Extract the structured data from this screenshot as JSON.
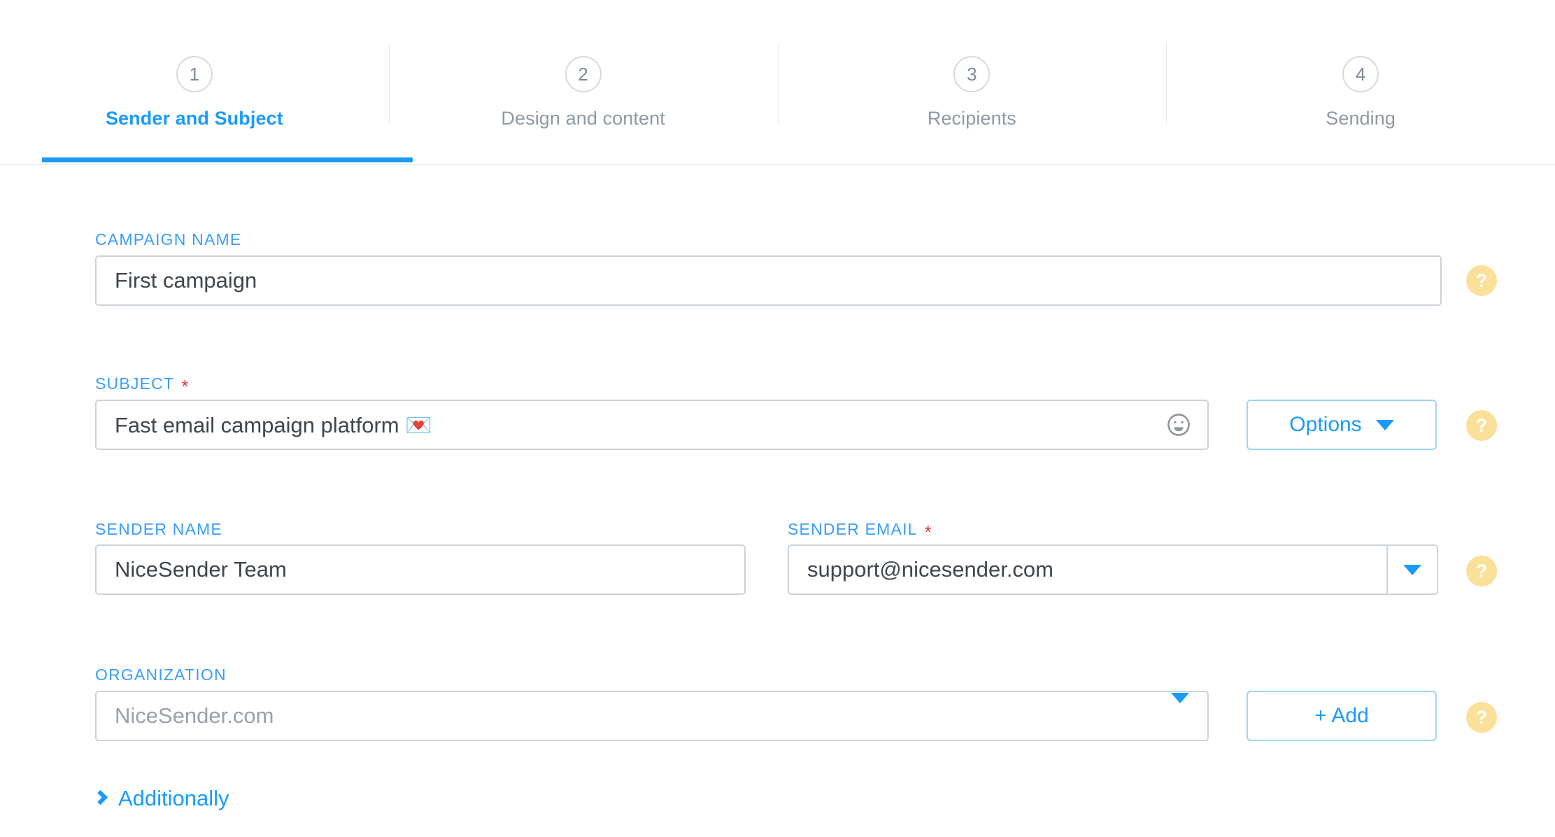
{
  "stepper": {
    "steps": [
      {
        "number": "1",
        "label": "Sender and Subject",
        "active": true
      },
      {
        "number": "2",
        "label": "Design and content",
        "active": false
      },
      {
        "number": "3",
        "label": "Recipients",
        "active": false
      },
      {
        "number": "4",
        "label": "Sending",
        "active": false
      }
    ],
    "active_accent_color": "#1a9bfc",
    "inactive_text_color": "#8d99a6"
  },
  "form": {
    "campaign_name": {
      "label": "CAMPAIGN NAME",
      "value": "First campaign",
      "required": false,
      "help_icon": "?"
    },
    "subject": {
      "label": "SUBJECT",
      "required_mark": "*",
      "value": "Fast email campaign platform 💌",
      "emoji_picker_icon": "☺",
      "options_button": "Options",
      "help_icon": "?"
    },
    "sender_name": {
      "label": "SENDER NAME",
      "value": "NiceSender Team",
      "required": false
    },
    "sender_email": {
      "label": "SENDER EMAIL",
      "required_mark": "*",
      "value": "support@nicesender.com",
      "dropdown_icon": "▼",
      "help_icon": "?"
    },
    "organization": {
      "label": "ORGANIZATION",
      "value": "NiceSender.com",
      "is_placeholder": true,
      "dropdown_icon": "▼",
      "add_button": "+ Add",
      "help_icon": "?"
    },
    "additionally": {
      "label": "Additionally",
      "chevron_icon": "chevron-right"
    }
  },
  "colors": {
    "accent_blue": "#1a9bfc",
    "label_blue": "#3a9dfb",
    "help_yellow": "#fbe09a",
    "required_red": "#e03b3b",
    "border_gray": "#ccd3da",
    "text_dark": "#3f4650",
    "placeholder_gray": "#9aa1a9"
  }
}
